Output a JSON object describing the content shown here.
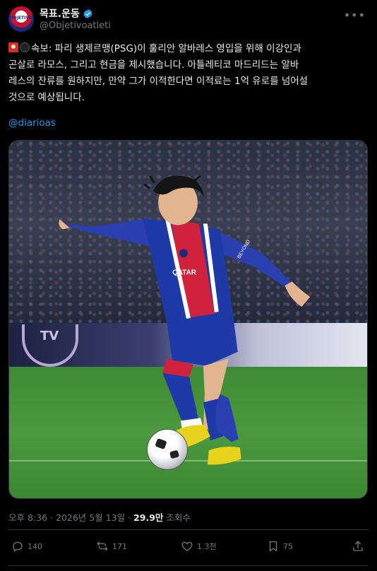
{
  "author": {
    "display_name": "목표.운동",
    "handle": "@Objetivoatleti",
    "avatar_text": "OBJETIVO",
    "verified": true
  },
  "tweet": {
    "line1": "속보: 파리 생제르맹(PSG)이 훌리안 알바레스 영입을 위해 이강인과",
    "line2": "곤살로 라모스, 그리고 현금을 제시했습니다. 아틀레티코 마드리드는 알바",
    "line3": "레스의 잔류를 원하지만, 만약 그가 이적한다면 이적료는 1억 유로를 넘어설",
    "line4": "것으로 예상됩니다.",
    "mention": "@diarioas"
  },
  "media": {
    "board_text": "TV",
    "jersey_sponsor": "QATAR",
    "sleeve_text": "BEYOND"
  },
  "meta": {
    "time": "오후 8:36",
    "separator": "·",
    "date": "2026년 5월 13일",
    "views_count": "29.9만",
    "views_label": "조회수"
  },
  "actions": {
    "replies": "140",
    "reposts": "171",
    "likes": "1.3천",
    "bookmarks": "75"
  },
  "colors": {
    "background": "#000000",
    "text": "#e7e9ea",
    "muted": "#71767b",
    "link": "#1d9bf0",
    "verified": "#1d9bf0"
  }
}
